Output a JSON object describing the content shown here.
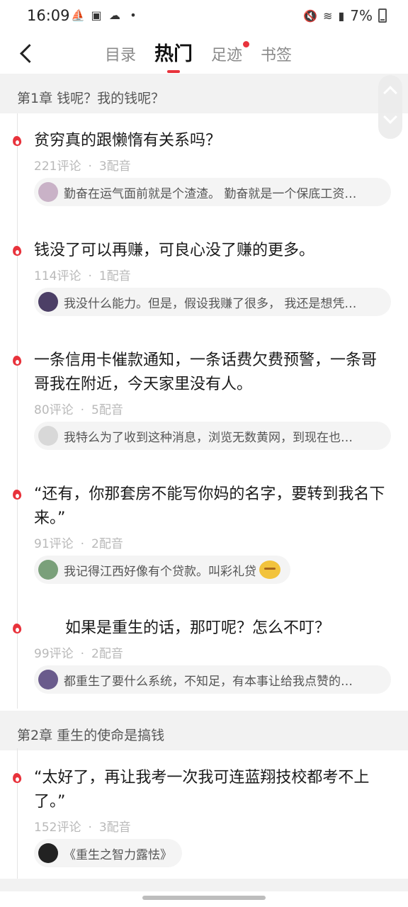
{
  "status_bar": {
    "time": "16:09",
    "battery": "7%",
    "left_icons": [
      "notification-icon",
      "image-icon",
      "cloud-icon",
      "dot-icon"
    ],
    "right_icons": [
      "mute-icon",
      "wifi-icon",
      "signal-icon",
      "battery-icon"
    ]
  },
  "nav": {
    "tabs": [
      {
        "label": "目录",
        "active": false
      },
      {
        "label": "热门",
        "active": true
      },
      {
        "label": "足迹",
        "active": false,
        "badge": true
      },
      {
        "label": "书签",
        "active": false
      }
    ]
  },
  "chapters": [
    {
      "title": "第1章 钱呢？我的钱呢？",
      "items": [
        {
          "title": "贫穷真的跟懒惰有关系吗？",
          "comments": "221评论",
          "dubs": "3配音",
          "top_comment": "勤奋在运气面前就是个渣渣。 勤奋就是一个保底工资…"
        },
        {
          "title": "钱没了可以再赚，可良心没了赚的更多。",
          "comments": "114评论",
          "dubs": "1配音",
          "top_comment": "我没什么能力。但是，假设我赚了很多， 我还是想凭…"
        },
        {
          "title": "一条信用卡催款通知，一条话费欠费预警，一条哥哥我在附近，今天家里没有人。",
          "comments": "80评论",
          "dubs": "5配音",
          "top_comment": "我特么为了收到这种消息，浏览无数黄网，到现在也…"
        },
        {
          "title": "“还有，你那套房不能写你妈的名字，要转到我名下来。”",
          "comments": "91评论",
          "dubs": "2配音",
          "top_comment": "我记得江西好像有个贷款。叫彩礼贷"
        },
        {
          "title": "　　如果是重生的话，那叮呢？怎么不叮？",
          "comments": "99评论",
          "dubs": "2配音",
          "top_comment": "都重生了要什么系统，不知足，有本事让给我点赞的…"
        }
      ]
    },
    {
      "title": "第2章 重生的使命是搞钱",
      "items": [
        {
          "title": "“太好了，再让我考一次我可连蓝翔技校都考不上了。”",
          "comments": "152评论",
          "dubs": "3配音",
          "top_comment": "《重生之智力露怯》"
        }
      ]
    }
  ],
  "colors": {
    "accent": "#e8333c",
    "chapter_bg": "#f2f2f2",
    "meta_text": "#b9b9b9"
  }
}
